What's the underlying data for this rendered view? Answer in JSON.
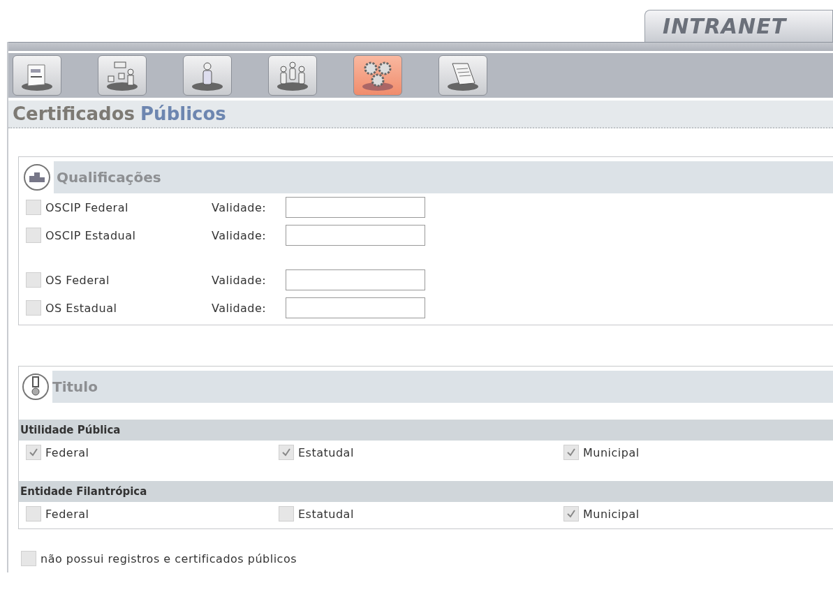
{
  "header": {
    "logo": "INTRANET"
  },
  "toolbar": [
    {
      "selected": false
    },
    {
      "selected": false
    },
    {
      "selected": false
    },
    {
      "selected": false
    },
    {
      "selected": true
    },
    {
      "selected": false
    }
  ],
  "page_title": {
    "first": "Certificados",
    "second": "Públicos"
  },
  "qualificacoes": {
    "title": "Qualificações",
    "groups": [
      [
        {
          "label": "OSCIP Federal",
          "checked": false,
          "field_label": "Validade:"
        },
        {
          "label": "OSCIP Estadual",
          "checked": false,
          "field_label": "Validade:"
        }
      ],
      [
        {
          "label": "OS Federal",
          "checked": false,
          "field_label": "Validade:"
        },
        {
          "label": "OS Estadual",
          "checked": false,
          "field_label": "Validade:"
        }
      ]
    ]
  },
  "titulo": {
    "title": "Titulo",
    "groups": [
      {
        "heading": "Utilidade Pública",
        "options": [
          {
            "label": "Federal",
            "checked": true
          },
          {
            "label": "Estatudal",
            "checked": true
          },
          {
            "label": "Municipal",
            "checked": true
          }
        ]
      },
      {
        "heading": "Entidade Filantrópica",
        "options": [
          {
            "label": "Federal",
            "checked": false
          },
          {
            "label": "Estatudal",
            "checked": false
          },
          {
            "label": "Municipal",
            "checked": true
          }
        ]
      }
    ]
  },
  "no_records": {
    "label": "não possui registros e certificados públicos",
    "checked": false
  }
}
